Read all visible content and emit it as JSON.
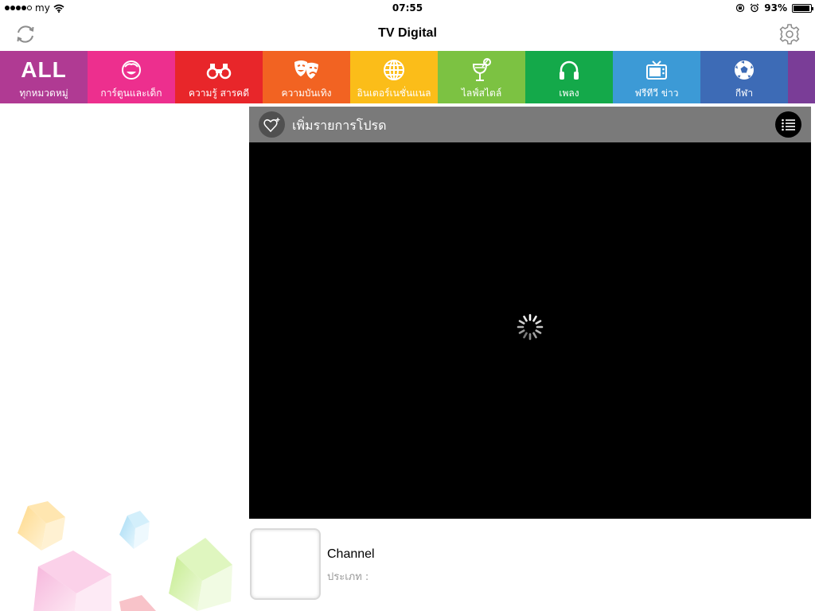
{
  "status_bar": {
    "carrier": "my",
    "time": "07:55",
    "battery": "93%",
    "battery_level": 0.93
  },
  "nav": {
    "title": "TV Digital",
    "left_icon": "refresh-icon",
    "right_icon": "gear-icon"
  },
  "categories": [
    {
      "icon": "ALL",
      "label": "ทุกหมวดหมู่",
      "color": "#b03a93"
    },
    {
      "icon": "smiley-face-icon",
      "label": "การ์ตูนและเด็ก",
      "color": "#ed2f8e"
    },
    {
      "icon": "binoculars-icon",
      "label": "ความรู้ สารคดี",
      "color": "#e8262a"
    },
    {
      "icon": "theater-masks-icon",
      "label": "ความบันเทิง",
      "color": "#f26322"
    },
    {
      "icon": "globe-icon",
      "label": "อินเตอร์เนชั่นแนล",
      "color": "#fbbd19"
    },
    {
      "icon": "cocktail-glass-icon",
      "label": "ไลฟ์สไตล์",
      "color": "#7cc242"
    },
    {
      "icon": "headphones-icon",
      "label": "เพลง",
      "color": "#14a94a"
    },
    {
      "icon": "tv-icon",
      "label": "ฟรีทีวี ข่าว",
      "color": "#3c9ad6"
    },
    {
      "icon": "soccer-ball-icon",
      "label": "กีฬา",
      "color": "#3d6bb6"
    },
    {
      "icon": "",
      "label": "",
      "color": "#7a3d97"
    }
  ],
  "favorites": {
    "label": "เพิ่มรายการโปรด",
    "heart_icon": "heart-add-icon",
    "list_icon": "list-icon"
  },
  "video": {
    "state_icon": "loading-spinner-icon"
  },
  "channel": {
    "name": "Channel",
    "type_label": "ประเภท :"
  }
}
